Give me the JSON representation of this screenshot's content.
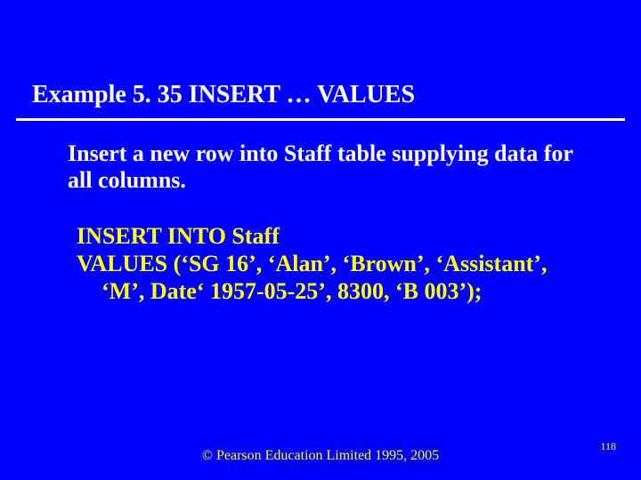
{
  "title": "Example 5. 35  INSERT … VALUES",
  "body": "Insert a new row into Staff table supplying data for all columns.",
  "code": {
    "line1": "INSERT INTO Staff",
    "line2": "VALUES  (‘SG 16’,  ‘Alan’,  ‘Brown’,  ‘Assistant’,",
    "line3": "‘M’, Date‘ 1957-05-25’, 8300, ‘B 003’);"
  },
  "footer": "© Pearson Education Limited 1995, 2005",
  "pagenum": "118"
}
